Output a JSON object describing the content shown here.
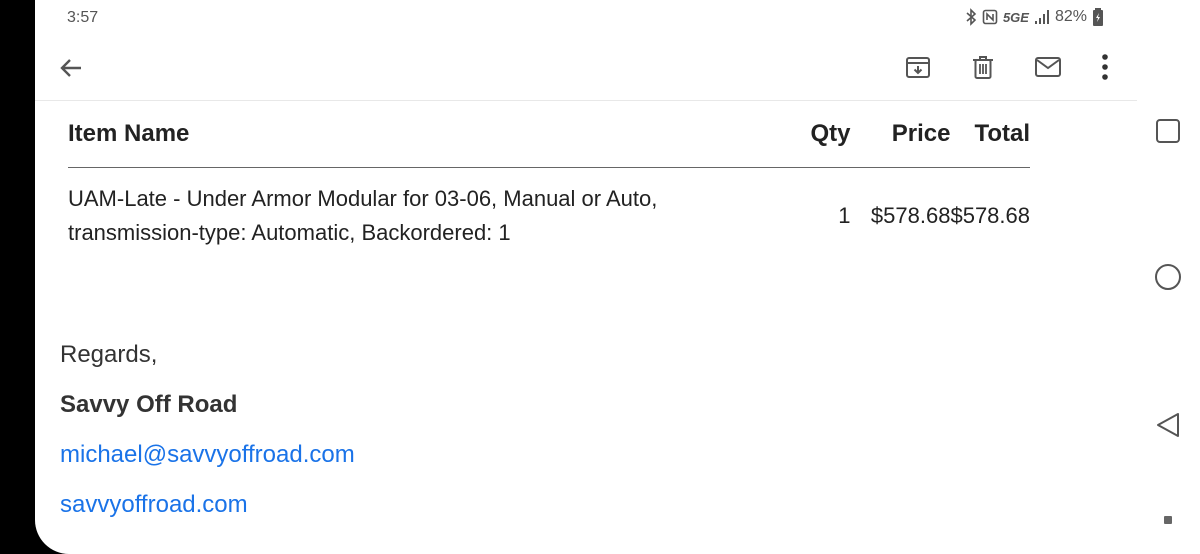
{
  "status": {
    "time": "3:57",
    "network": "5GE",
    "battery": "82%"
  },
  "toolbar": {
    "icons": [
      "back-arrow-icon",
      "archive-icon",
      "trash-icon",
      "mail-unread-icon",
      "more-vert-icon"
    ]
  },
  "table": {
    "headers": {
      "item": "Item Name",
      "qty": "Qty",
      "price": "Price",
      "total": "Total"
    },
    "rows": [
      {
        "item_line1": "UAM-Late - Under Armor Modular for 03-06, Manual or Auto,",
        "item_line2": "transmission-type: Automatic, Backordered: 1",
        "qty": "1",
        "price": "$578.68",
        "total": "$578.68"
      }
    ]
  },
  "signature": {
    "regards": "Regards,",
    "name": "Savvy Off Road",
    "email": "michael@savvyoffroad.com",
    "website": "savvyoffroad.com"
  },
  "colors": {
    "link": "#1a73e8",
    "text": "#222222"
  }
}
